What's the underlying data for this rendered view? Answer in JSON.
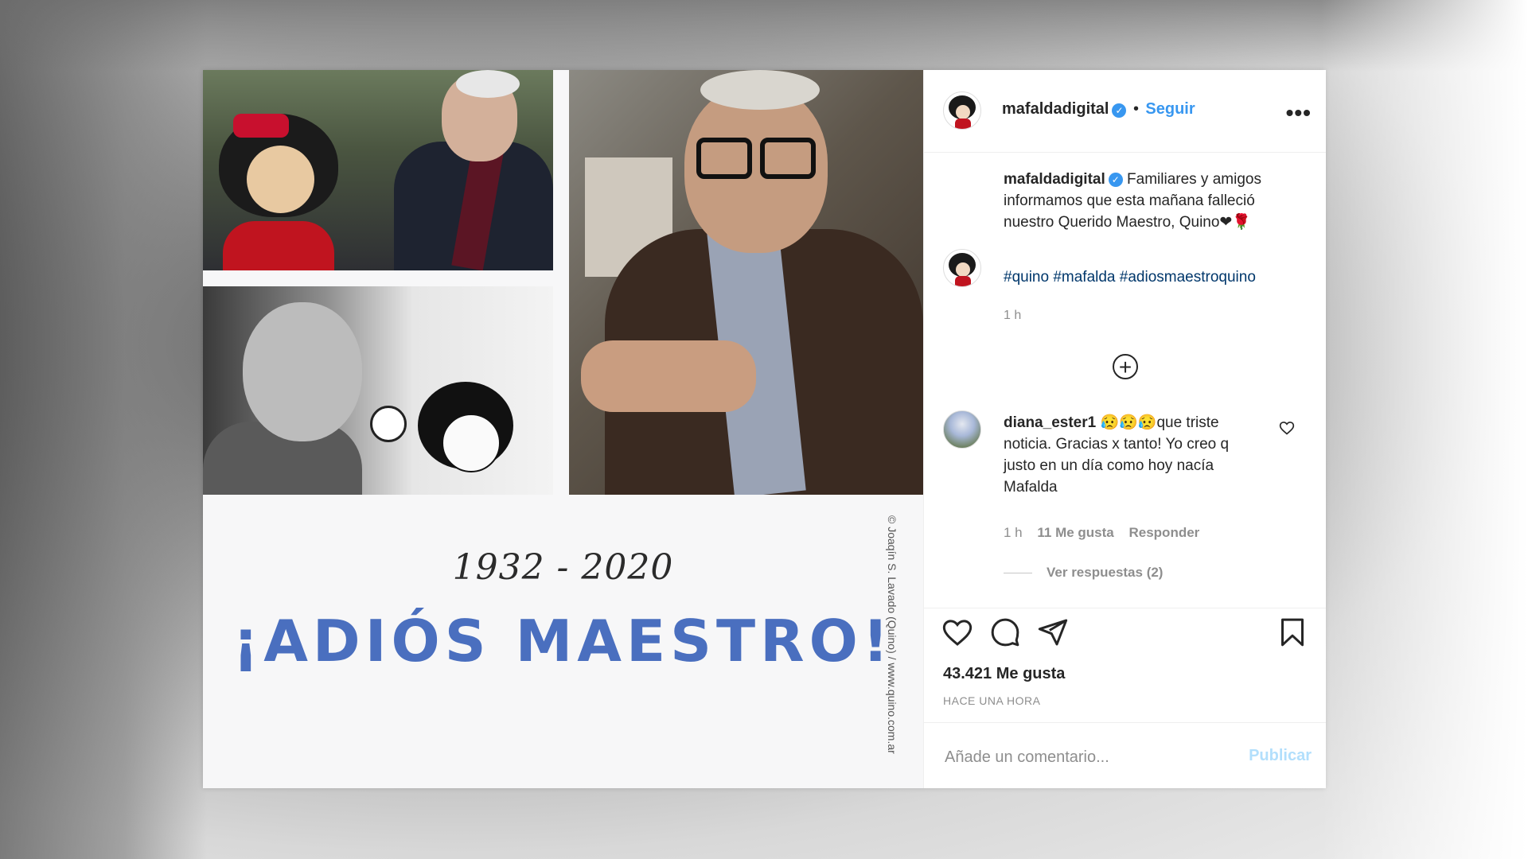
{
  "post": {
    "image": {
      "years": "1932 - 2020",
      "headline": "¡ADIÓS MAESTRO!",
      "credit": "© Joaqín S. Lavado (Quino) / www.quino.com.ar"
    },
    "header": {
      "username": "mafaldadigital",
      "separator": "•",
      "follow_label": "Seguir",
      "more_label": "•••"
    },
    "caption": {
      "username": "mafaldadigital",
      "text": "Familiares y amigos informamos que esta mañana falleció nuestro Querido Maestro, Quino",
      "emojis": "❤🌹",
      "hashtags": "#quino #mafalda #adiosmaestroquino",
      "time": "1 h"
    },
    "load_more_label": "+",
    "comment": {
      "username": "diana_ester1",
      "emojis": "😥😥😥",
      "text": "que triste noticia. Gracias x tanto! Yo creo q justo en un día como hoy nacía Mafalda",
      "time": "1 h",
      "likes": "11 Me gusta",
      "reply_label": "Responder",
      "view_replies": "Ver respuestas (2)"
    },
    "likes": "43.421 Me gusta",
    "posted": "HACE UNA HORA",
    "composer": {
      "placeholder": "Añade un comentario...",
      "publish_label": "Publicar"
    },
    "colors": {
      "accent": "#3897f0",
      "headline": "#4a6fbf",
      "publish_disabled": "#b2dffc"
    }
  }
}
